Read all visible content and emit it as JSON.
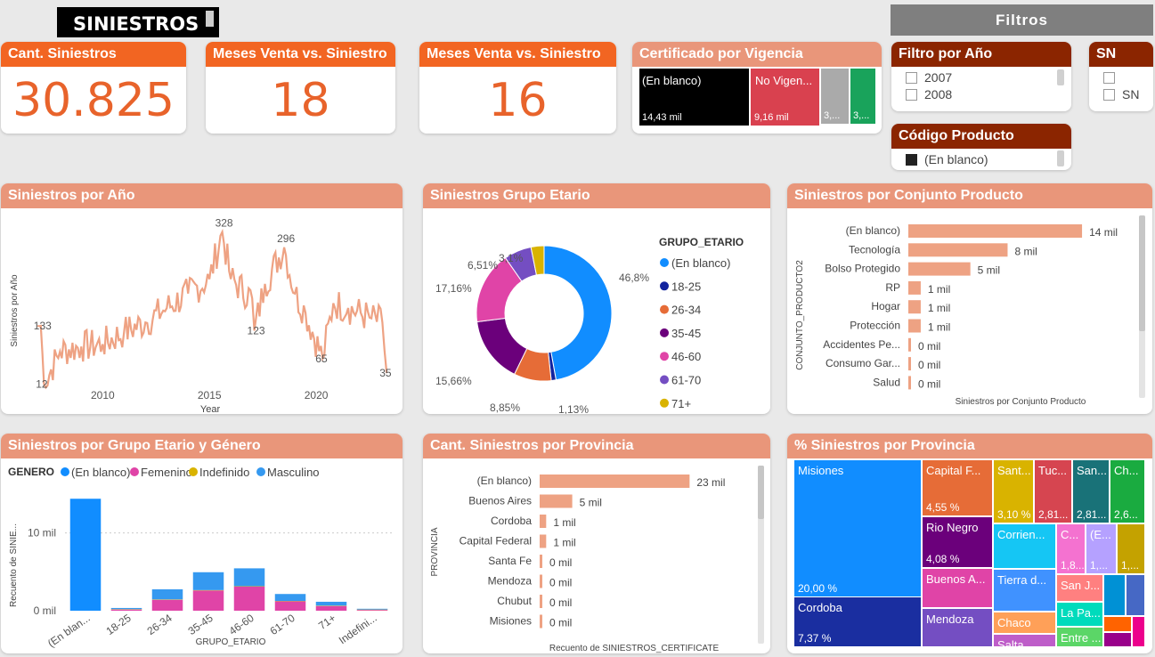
{
  "title": "SINIESTROS",
  "filtros_label": "Filtros",
  "kpis": [
    {
      "label": "Cant. Siniestros",
      "value": "30.825"
    },
    {
      "label": "Meses Venta vs. Siniestro",
      "value": "18"
    },
    {
      "label": "Meses Venta vs. Siniestro",
      "value": "16"
    }
  ],
  "certificado": {
    "title": "Certificado por Vigencia",
    "tiles": [
      {
        "label": "(En blanco)",
        "value": "14,43 mil",
        "color": "#000000"
      },
      {
        "label": "No Vigen...",
        "value": "9,16 mil",
        "color": "#d9414f"
      },
      {
        "label": "",
        "value": "3,...",
        "color": "#aaaaaa"
      },
      {
        "label": "",
        "value": "3,...",
        "color": "#19a35b"
      }
    ]
  },
  "filtro_anio": {
    "title": "Filtro por Año",
    "items": [
      "2007",
      "2008"
    ]
  },
  "sn": {
    "title": "SN",
    "items": [
      "",
      "SN"
    ]
  },
  "codigo_producto": {
    "title": "Código Producto",
    "items": [
      "(En blanco)"
    ]
  },
  "colors": {
    "accent": "#e8632b",
    "salmon": "#e9967a",
    "brown": "#8b2500",
    "bar": "#eea283"
  },
  "chart_data": [
    {
      "id": "siniestros_por_anio",
      "type": "line",
      "title": "Siniestros por Año",
      "xlabel": "Year",
      "ylabel": "Siniestros por Año",
      "xticks": [
        2010,
        2015,
        2020
      ],
      "xlim": [
        2006.9,
        2023.5
      ],
      "ylim": [
        0,
        340
      ],
      "annotations": [
        {
          "x": 2007.1,
          "y": 133,
          "label": "133"
        },
        {
          "x": 2007.2,
          "y": 12,
          "label": "12"
        },
        {
          "x": 2015.6,
          "y": 328,
          "label": "328"
        },
        {
          "x": 2018.5,
          "y": 296,
          "label": "296"
        },
        {
          "x": 2017.1,
          "y": 123,
          "label": "123"
        },
        {
          "x": 2020.3,
          "y": 65,
          "label": "65"
        },
        {
          "x": 2023.3,
          "y": 35,
          "label": "35"
        }
      ],
      "color": "#eea283"
    },
    {
      "id": "siniestros_grupo_etario",
      "type": "pie",
      "title": "Siniestros Grupo Etario",
      "legend_title": "GRUPO_ETARIO",
      "slices": [
        {
          "name": "(En blanco)",
          "value": 46.8,
          "label": "46,8%",
          "color": "#118dff"
        },
        {
          "name": "18-25",
          "value": 1.13,
          "label": "1,13%",
          "color": "#12239e"
        },
        {
          "name": "26-34",
          "value": 8.85,
          "label": "8,85%",
          "color": "#e66c37"
        },
        {
          "name": "35-45",
          "value": 15.66,
          "label": "15,66%",
          "color": "#6b007b"
        },
        {
          "name": "46-60",
          "value": 17.16,
          "label": "17,16%",
          "color": "#e044a7"
        },
        {
          "name": "61-70",
          "value": 6.51,
          "label": "6,51%",
          "color": "#744ec2"
        },
        {
          "name": "71+",
          "value": 3.1,
          "label": "3,1%",
          "color": "#d9b300"
        }
      ]
    },
    {
      "id": "siniestros_conjunto_producto",
      "type": "bar",
      "title": "Siniestros por Conjunto Producto",
      "xlabel": "Siniestros por Conjunto Producto",
      "ylabel": "CONJUNTO_PRODUCTO2",
      "categories": [
        "(En blanco)",
        "Tecnología",
        "Bolso Protegido",
        "RP",
        "Hogar",
        "Protección",
        "Accidentes Pe...",
        "Consumo Gar...",
        "Salud"
      ],
      "values": [
        14,
        8,
        5,
        1,
        1,
        1,
        0,
        0,
        0
      ],
      "value_labels": [
        "14 mil",
        "8 mil",
        "5 mil",
        "1 mil",
        "1 mil",
        "1 mil",
        "0 mil",
        "0 mil",
        "0 mil"
      ],
      "xlim": [
        0,
        15
      ]
    },
    {
      "id": "siniestros_grupo_etario_genero",
      "type": "bar",
      "title": "Siniestros por Grupo Etario y Género",
      "legend_title": "GENERO",
      "xlabel": "GRUPO_ETARIO",
      "ylabel": "Recuento de SINIE...",
      "categories": [
        "(En blan...",
        "18-25",
        "26-34",
        "35-45",
        "46-60",
        "61-70",
        "71+",
        "Indefini..."
      ],
      "yticks": [
        "0 mil",
        "10 mil"
      ],
      "ylim": [
        0,
        15
      ],
      "series": [
        {
          "name": "(En blanco)",
          "color": "#118dff",
          "values": [
            14.4,
            0,
            0,
            0,
            0,
            0,
            0,
            0
          ]
        },
        {
          "name": "Femenino",
          "color": "#e044a7",
          "values": [
            0,
            0.15,
            1.4,
            2.6,
            3.1,
            1.2,
            0.6,
            0.1
          ]
        },
        {
          "name": "Indefinido",
          "color": "#d9b300",
          "values": [
            0,
            0.05,
            0.05,
            0.05,
            0.05,
            0.05,
            0.05,
            0.05
          ]
        },
        {
          "name": "Masculino",
          "color": "#3599f0",
          "values": [
            0,
            0.15,
            1.3,
            2.3,
            2.3,
            0.9,
            0.5,
            0.1
          ]
        }
      ]
    },
    {
      "id": "siniestros_por_provincia",
      "type": "bar",
      "title": "Cant. Siniestros por Provincia",
      "xlabel": "Recuento de SINIESTROS_CERTIFICATE",
      "ylabel": "PROVINCIA",
      "categories": [
        "(En blanco)",
        "Buenos Aires",
        "Cordoba",
        "Capital Federal",
        "Santa Fe",
        "Mendoza",
        "Chubut",
        "Misiones"
      ],
      "values": [
        23,
        5,
        1,
        1,
        0,
        0,
        0,
        0
      ],
      "value_labels": [
        "23 mil",
        "5 mil",
        "1 mil",
        "1 mil",
        "0 mil",
        "0 mil",
        "0 mil",
        "0 mil"
      ],
      "xlim": [
        0,
        25
      ]
    },
    {
      "id": "pct_siniestros_provincia",
      "type": "treemap",
      "title": "% Siniestros por Provincia",
      "tiles": [
        {
          "name": "Misiones",
          "pct": "20,00 %",
          "color": "#118dff"
        },
        {
          "name": "Cordoba",
          "pct": "7,37 %",
          "color": "#1a2ea0"
        },
        {
          "name": "Capital F...",
          "pct": "4,55 %",
          "color": "#e66c37"
        },
        {
          "name": "Rio Negro",
          "pct": "4,08 %",
          "color": "#6b007b"
        },
        {
          "name": "Buenos A...",
          "pct": "",
          "color": "#e044a7"
        },
        {
          "name": "Mendoza",
          "pct": "",
          "color": "#744ec2"
        },
        {
          "name": "Sant...",
          "pct": "3,10 %",
          "color": "#d9b300"
        },
        {
          "name": "Tuc...",
          "pct": "2,81...",
          "color": "#d64550"
        },
        {
          "name": "San...",
          "pct": "2,81...",
          "color": "#197278"
        },
        {
          "name": "Ch...",
          "pct": "2,6...",
          "color": "#1aab40"
        },
        {
          "name": "Corrien...",
          "pct": "",
          "color": "#15c6f4"
        },
        {
          "name": "Tierra d...",
          "pct": "",
          "color": "#4092ff"
        },
        {
          "name": "Chaco",
          "pct": "",
          "color": "#ffa058"
        },
        {
          "name": "Salta",
          "pct": "",
          "color": "#be5dc9"
        },
        {
          "name": "C...",
          "pct": "1,8...",
          "color": "#f472d0"
        },
        {
          "name": "(E...",
          "pct": "1,...",
          "color": "#b5a1ff"
        },
        {
          "name": "",
          "pct": "1,...",
          "color": "#c4a200"
        },
        {
          "name": "San J...",
          "pct": "",
          "color": "#ff8080"
        },
        {
          "name": "La Pa...",
          "pct": "",
          "color": "#00dbbc"
        },
        {
          "name": "Entre ...",
          "pct": "",
          "color": "#5bd667"
        },
        {
          "name": "",
          "pct": "",
          "color": "#0091d5"
        },
        {
          "name": "",
          "pct": "",
          "color": "#4668c5"
        },
        {
          "name": "",
          "pct": "",
          "color": "#ff6300"
        },
        {
          "name": "",
          "pct": "",
          "color": "#99008a"
        },
        {
          "name": "",
          "pct": "",
          "color": "#ec008c"
        }
      ]
    }
  ]
}
